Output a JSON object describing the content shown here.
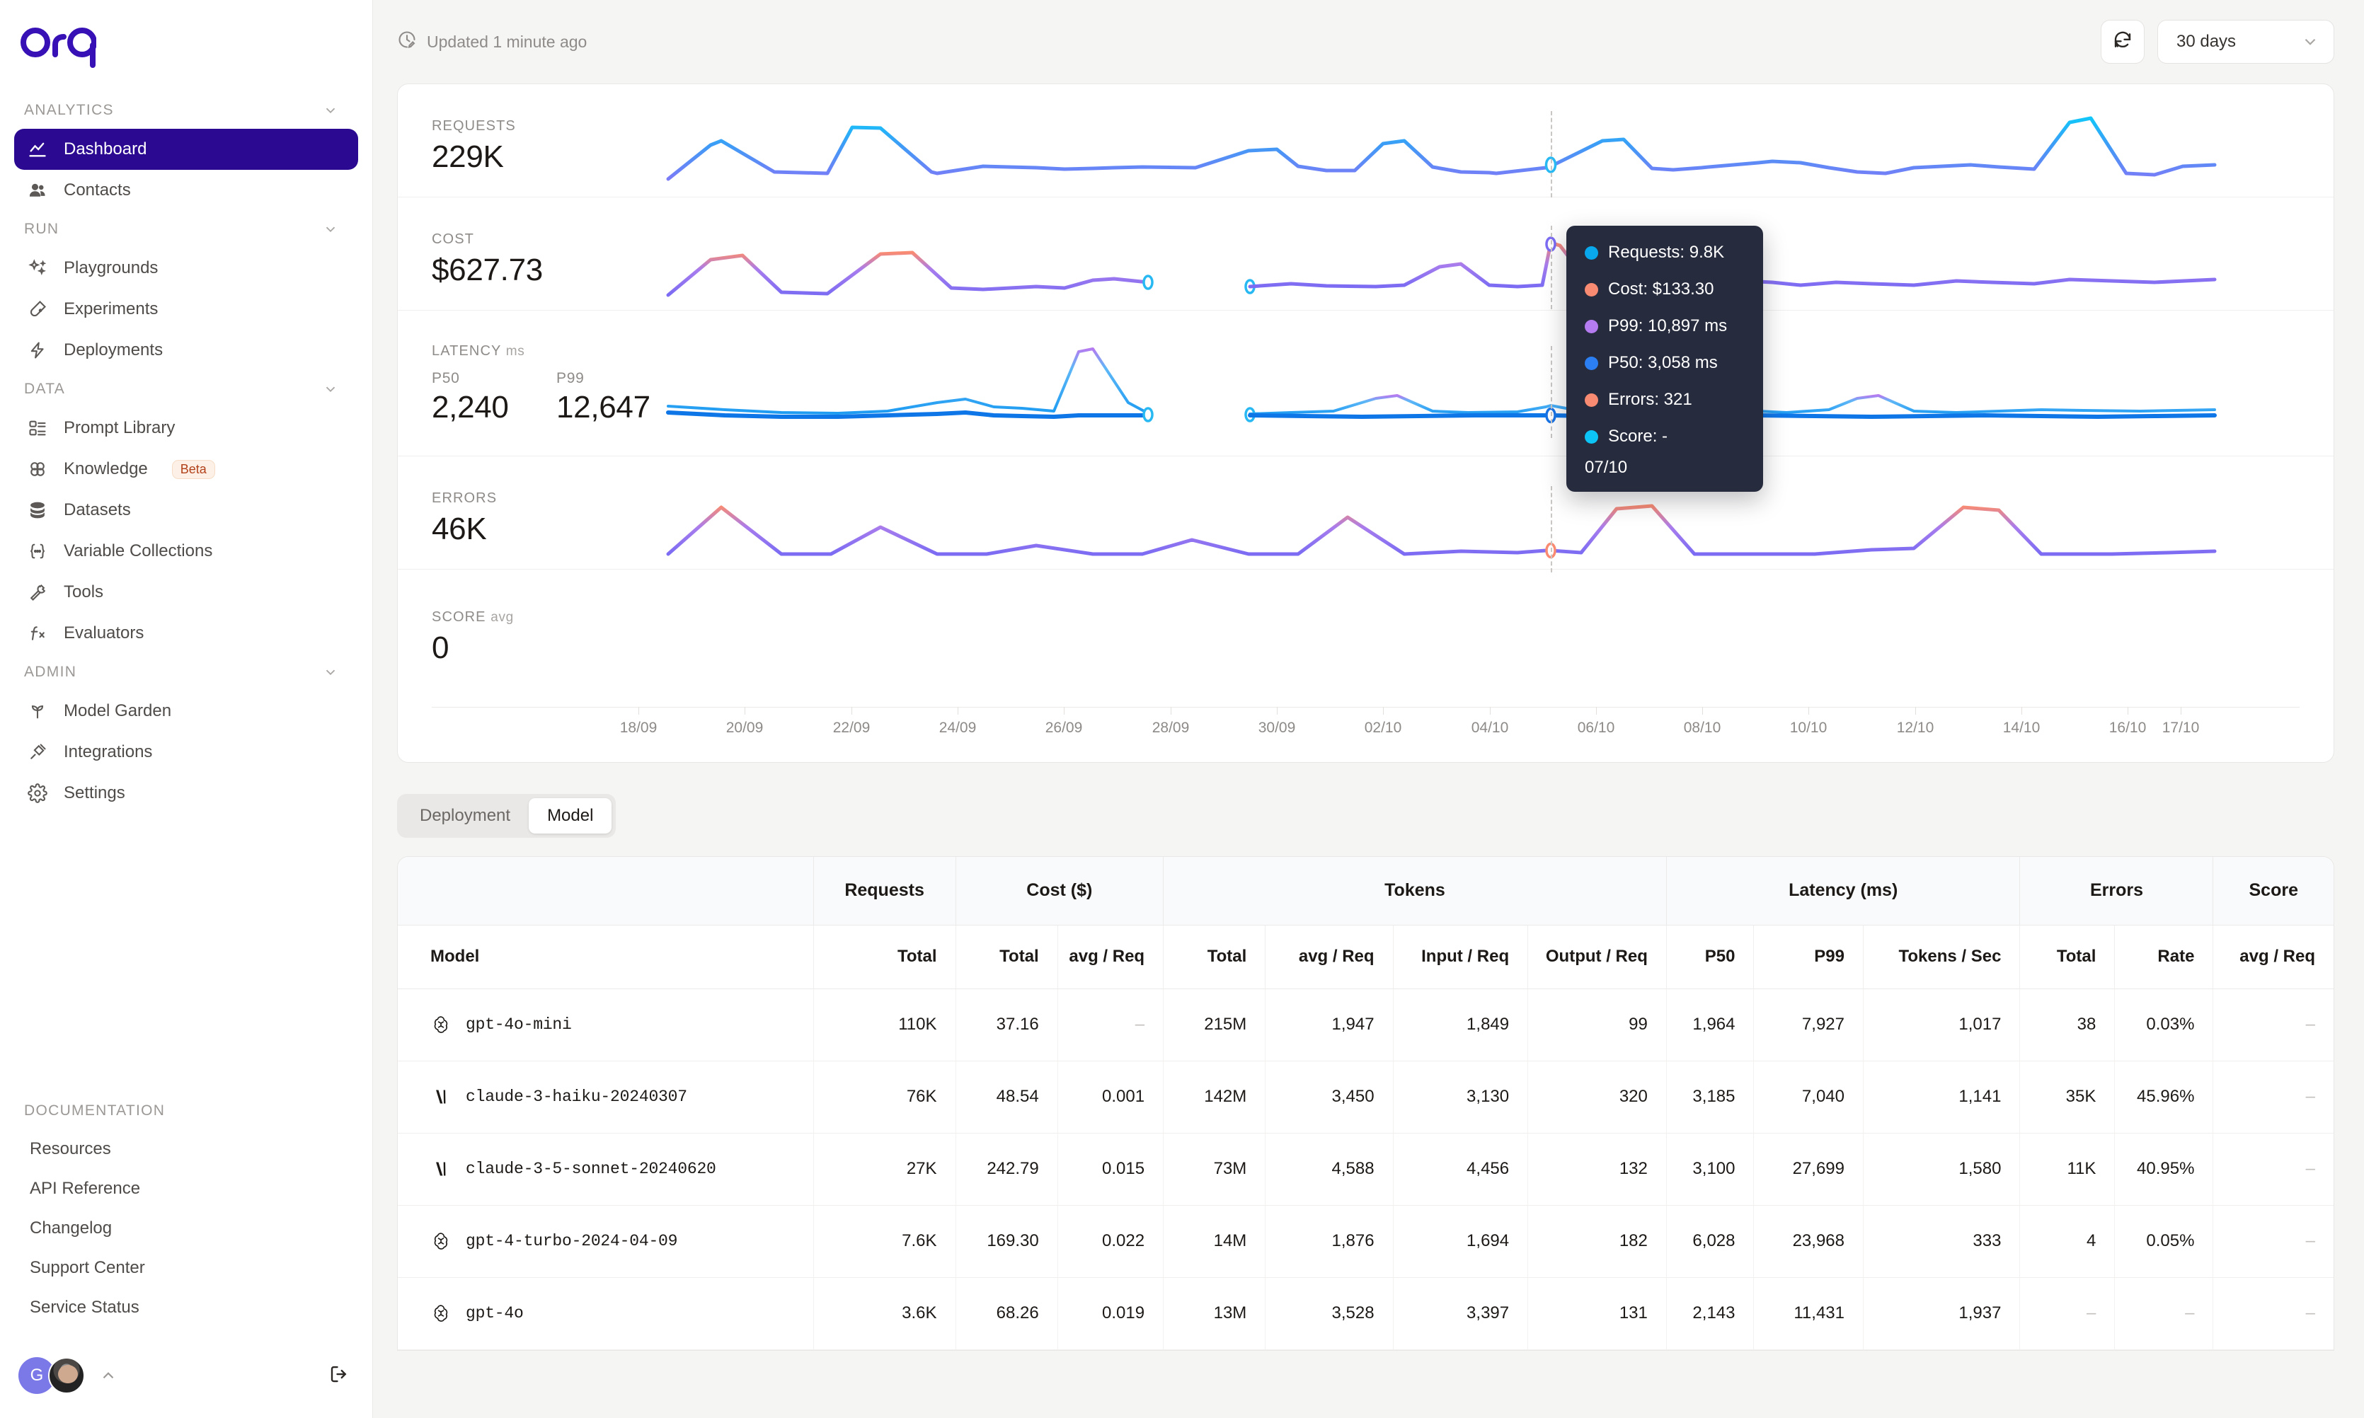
{
  "brand": {
    "name": "orq",
    "logo_color": "#3711b5",
    "accent": "#2b0a91"
  },
  "sidebar": {
    "sections": [
      {
        "label": "ANALYTICS",
        "items": [
          {
            "label": "Dashboard",
            "icon": "line-chart-icon",
            "active": true
          },
          {
            "label": "Contacts",
            "icon": "users-icon",
            "active": false
          }
        ]
      },
      {
        "label": "RUN",
        "items": [
          {
            "label": "Playgrounds",
            "icon": "sparkles-icon",
            "active": false
          },
          {
            "label": "Experiments",
            "icon": "test-tube-icon",
            "active": false
          },
          {
            "label": "Deployments",
            "icon": "bolt-icon",
            "active": false
          }
        ]
      },
      {
        "label": "DATA",
        "items": [
          {
            "label": "Prompt Library",
            "icon": "layout-list-icon",
            "active": false
          },
          {
            "label": "Knowledge",
            "icon": "clover-icon",
            "active": false,
            "badge": "Beta"
          },
          {
            "label": "Datasets",
            "icon": "database-icon",
            "active": false
          },
          {
            "label": "Variable Collections",
            "icon": "braces-icon",
            "active": false
          },
          {
            "label": "Tools",
            "icon": "wrench-icon",
            "active": false
          },
          {
            "label": "Evaluators",
            "icon": "function-icon",
            "active": false
          }
        ]
      },
      {
        "label": "ADMIN",
        "items": [
          {
            "label": "Model Garden",
            "icon": "sprout-icon",
            "active": false
          },
          {
            "label": "Integrations",
            "icon": "plug-icon",
            "active": false
          },
          {
            "label": "Settings",
            "icon": "gear-icon",
            "active": false
          }
        ]
      }
    ],
    "documentation": {
      "label": "DOCUMENTATION",
      "items": [
        "Resources",
        "API Reference",
        "Changelog",
        "Support Center",
        "Service Status"
      ]
    },
    "footer": {
      "org_initial": "G",
      "user_avatar": "user-photo",
      "expand_icon": "chevron-up-icon",
      "logout_icon": "logout-icon"
    }
  },
  "topbar": {
    "updated_text": "Updated 1 minute ago",
    "clock_icon": "clock-edit-icon",
    "refresh_icon": "refresh-icon",
    "range_value": "30 days",
    "range_caret": "chevron-down-icon"
  },
  "metrics": [
    {
      "label": "REQUESTS",
      "unit": "",
      "value": "229K"
    },
    {
      "label": "COST",
      "unit": "",
      "value": "$627.73"
    },
    {
      "label": "LATENCY",
      "unit": "ms",
      "sub": [
        {
          "label": "P50",
          "value": "2,240"
        },
        {
          "label": "P99",
          "value": "12,647"
        }
      ]
    },
    {
      "label": "ERRORS",
      "unit": "",
      "value": "46K"
    },
    {
      "label": "SCORE",
      "unit": "avg",
      "value": "0"
    }
  ],
  "tooltip": {
    "rows": [
      {
        "color": "#09a8ec",
        "text": "Requests: 9.8K"
      },
      {
        "color": "#f98b72",
        "text": "Cost: $133.30"
      },
      {
        "color": "#b57bf0",
        "text": "P99: 10,897 ms"
      },
      {
        "color": "#2b7ff2",
        "text": "P50: 3,058 ms"
      },
      {
        "color": "#f98b72",
        "text": "Errors: 321"
      },
      {
        "color": "#0cc4f5",
        "text": "Score: -"
      }
    ],
    "date": "07/10"
  },
  "chart_data": {
    "type": "line",
    "title": "",
    "xlabel": "",
    "ylabel": "",
    "grid": false,
    "legend_position": "tooltip",
    "x_tick_labels": [
      "18/09",
      "20/09",
      "22/09",
      "24/09",
      "26/09",
      "28/09",
      "30/09",
      "02/10",
      "04/10",
      "06/10",
      "08/10",
      "10/10",
      "12/10",
      "14/10",
      "16/10",
      "17/10"
    ],
    "hover_date": "07/10",
    "series": [
      {
        "name": "Requests",
        "panel": "REQUESTS",
        "color": "#3e7bf6",
        "total": "229K",
        "values": [
          2.0,
          6.5,
          5.4,
          2.4,
          2.3,
          9.0,
          2.3,
          2.9,
          2.7,
          2.3,
          2.3,
          2.2,
          6.0,
          2.5,
          2.3,
          7.2,
          2.4,
          2.3,
          9.8,
          2.9,
          7.0,
          2.4,
          3.0,
          2.5,
          2.4,
          2.5,
          10.5,
          2.7,
          2.8,
          2.6
        ],
        "unit": "K"
      },
      {
        "name": "Cost",
        "panel": "COST",
        "color": "#8b6cf0",
        "total": "$627.73",
        "values": [
          6,
          28,
          34,
          11,
          11,
          33,
          11,
          15,
          16,
          17,
          22,
          null,
          14,
          15,
          16,
          17,
          18,
          25,
          20,
          16,
          133,
          18,
          20,
          32,
          22,
          20,
          22,
          25,
          24,
          26
        ],
        "unit": "$"
      },
      {
        "name": "P50",
        "panel": "LATENCY",
        "color": "#1e82f0",
        "total": "2,240",
        "values": [
          2300,
          2200,
          2150,
          2100,
          2180,
          2250,
          2600,
          2300,
          2200,
          2240,
          null,
          2100,
          2200,
          2400,
          2250,
          2200,
          3058,
          2200,
          2250,
          2300,
          2500,
          2400,
          2300,
          2250,
          2200,
          2300,
          2400,
          2300,
          2250,
          2240
        ]
      },
      {
        "name": "P99",
        "panel": "LATENCY",
        "color": "#b57bf0",
        "total": "12,647",
        "values": [
          3500,
          3200,
          3100,
          3000,
          3300,
          3400,
          5200,
          3200,
          3100,
          3000,
          null,
          3100,
          3200,
          4200,
          3300,
          3200,
          3400,
          3100,
          3200,
          3300,
          3600,
          6200,
          3400,
          6100,
          3300,
          3200,
          3400,
          3300,
          3200,
          3100
        ]
      },
      {
        "name": "Errors",
        "panel": "ERRORS",
        "color": "#8b6cf0",
        "total": "46K",
        "values": [
          100,
          900,
          2100,
          200,
          200,
          1400,
          200,
          200,
          700,
          200,
          200,
          1000,
          200,
          200,
          2000,
          300,
          350,
          321,
          350,
          2400,
          300,
          300,
          300,
          300,
          400,
          2200,
          300,
          300,
          300,
          350
        ]
      },
      {
        "name": "Score",
        "panel": "SCORE",
        "color": "#0cc4f5",
        "total": "0",
        "values": []
      }
    ]
  },
  "table": {
    "tabs": [
      {
        "label": "Deployment",
        "active": false
      },
      {
        "label": "Model",
        "active": true
      }
    ],
    "group_headers": [
      {
        "label": "",
        "span": 1
      },
      {
        "label": "Requests",
        "span": 1
      },
      {
        "label": "Cost ($)",
        "span": 2
      },
      {
        "label": "Tokens",
        "span": 4
      },
      {
        "label": "Latency (ms)",
        "span": 3
      },
      {
        "label": "Errors",
        "span": 2
      },
      {
        "label": "Score",
        "span": 1
      }
    ],
    "sub_headers": [
      "Model",
      "Total",
      "Total",
      "avg / Req",
      "Total",
      "avg / Req",
      "Input / Req",
      "Output / Req",
      "P50",
      "P99",
      "Tokens / Sec",
      "Total",
      "Rate",
      "avg / Req"
    ],
    "rows": [
      {
        "provider": "openai",
        "model": "gpt-4o-mini",
        "cells": [
          "110K",
          "37.16",
          "–",
          "215M",
          "1,947",
          "1,849",
          "99",
          "1,964",
          "7,927",
          "1,017",
          "38",
          "0.03%",
          "–"
        ]
      },
      {
        "provider": "anthropic",
        "model": "claude-3-haiku-20240307",
        "cells": [
          "76K",
          "48.54",
          "0.001",
          "142M",
          "3,450",
          "3,130",
          "320",
          "3,185",
          "7,040",
          "1,141",
          "35K",
          "45.96%",
          "–"
        ]
      },
      {
        "provider": "anthropic",
        "model": "claude-3-5-sonnet-20240620",
        "cells": [
          "27K",
          "242.79",
          "0.015",
          "73M",
          "4,588",
          "4,456",
          "132",
          "3,100",
          "27,699",
          "1,580",
          "11K",
          "40.95%",
          "–"
        ]
      },
      {
        "provider": "openai",
        "model": "gpt-4-turbo-2024-04-09",
        "cells": [
          "7.6K",
          "169.30",
          "0.022",
          "14M",
          "1,876",
          "1,694",
          "182",
          "6,028",
          "23,968",
          "333",
          "4",
          "0.05%",
          "–"
        ]
      },
      {
        "provider": "openai",
        "model": "gpt-4o",
        "cells": [
          "3.6K",
          "68.26",
          "0.019",
          "13M",
          "3,528",
          "3,397",
          "131",
          "2,143",
          "11,431",
          "1,937",
          "–",
          "–",
          "–"
        ]
      }
    ]
  }
}
